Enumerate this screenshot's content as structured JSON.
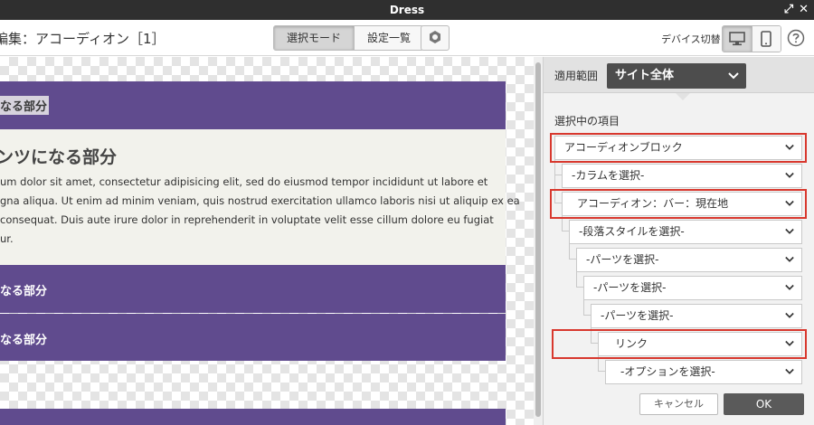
{
  "window": {
    "title": "Dress"
  },
  "toolbar": {
    "page_title": "編集：アコーディオン［1］",
    "mode_select_label": "選択モード",
    "settings_list_label": "設定一覧",
    "device_switch_label": "デバイス切替"
  },
  "canvas": {
    "band1_label": "なる部分",
    "content_heading": "ンツになる部分",
    "content_lines": [
      "um dolor sit amet, consectetur adipisicing elit, sed do eiusmod tempor incididunt ut labore et",
      "gna aliqua. Ut enim ad minim veniam, quis nostrud exercitation ullamco laboris nisi ut aliquip ex ea",
      "consequat. Duis aute irure dolor in reprehenderit in voluptate velit esse cillum dolore eu fugiat",
      "ur."
    ],
    "band2_label": "なる部分",
    "band3_label": "なる部分"
  },
  "panel": {
    "scope_label": "適用範囲",
    "scope_value": "サイト全体",
    "selected_items_label": "選択中の項目",
    "items": [
      {
        "label": "アコーディオンブロック",
        "highlighted": true
      },
      {
        "label": "-カラムを選択-",
        "highlighted": false
      },
      {
        "label": "アコーディオン：バー：現在地",
        "highlighted": true
      },
      {
        "label": "-段落スタイルを選択-",
        "highlighted": false
      },
      {
        "label": "-パーツを選択-",
        "highlighted": false
      },
      {
        "label": "-パーツを選択-",
        "highlighted": false
      },
      {
        "label": "-パーツを選択-",
        "highlighted": false
      },
      {
        "label": "リンク",
        "highlighted": true
      },
      {
        "label": "-オプションを選択-",
        "highlighted": false
      }
    ],
    "cancel_label": "キャンセル",
    "ok_label": "OK"
  },
  "colors": {
    "accent_purple": "#604b8e",
    "highlight_red": "#d8382e",
    "titlebar": "#2f2f2f"
  }
}
